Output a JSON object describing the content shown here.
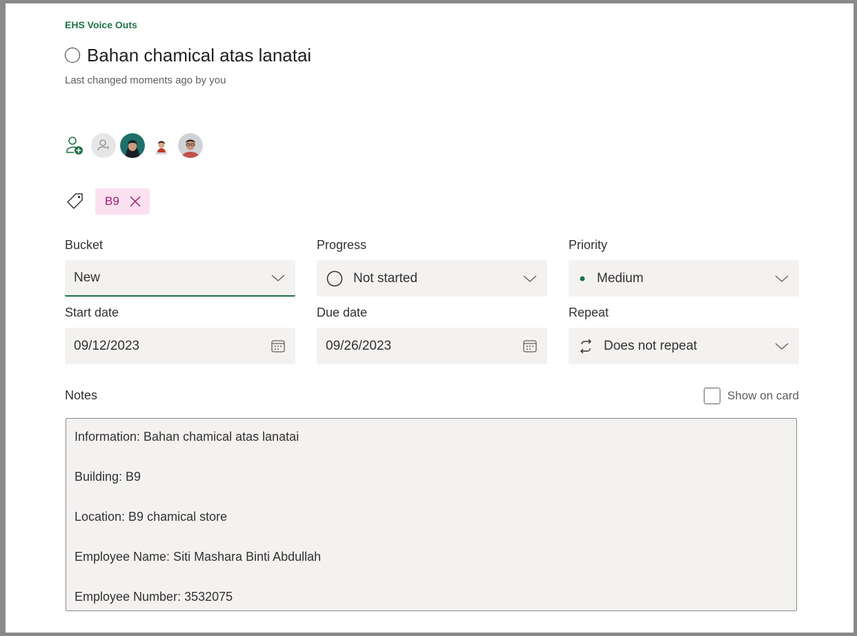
{
  "plan_name": "EHS Voice Outs",
  "task": {
    "title": "Bahan chamical atas lanatai",
    "last_changed": "Last changed moments ago by you"
  },
  "assignees": {
    "add_icon": "add-person-icon",
    "members": [
      {
        "icon": "person-unknown-icon"
      },
      {
        "icon": "avatar-photo"
      },
      {
        "icon": "avatar-photo"
      },
      {
        "icon": "avatar-photo"
      }
    ]
  },
  "labels": {
    "icon": "tag-icon",
    "items": [
      {
        "text": "B9",
        "color": "#fbe0f0"
      }
    ]
  },
  "fields": {
    "bucket": {
      "label": "Bucket",
      "value": "New"
    },
    "progress": {
      "label": "Progress",
      "value": "Not started"
    },
    "priority": {
      "label": "Priority",
      "value": "Medium",
      "dot_color": "#1e7145"
    },
    "start_date": {
      "label": "Start date",
      "value": "09/12/2023"
    },
    "due_date": {
      "label": "Due date",
      "value": "09/26/2023"
    },
    "repeat": {
      "label": "Repeat",
      "value": "Does not repeat"
    }
  },
  "notes": {
    "label": "Notes",
    "show_on_card": "Show on card",
    "show_on_card_checked": false,
    "lines": [
      "Information: Bahan chamical atas lanatai",
      "Building: B9",
      "Location: B9 chamical store",
      "Employee Name: Siti Mashara Binti Abdullah",
      "Employee Number: 3532075"
    ]
  },
  "colors": {
    "accent": "#1e7145",
    "field_bg": "#f3f2f1",
    "label_pink_bg": "#fbe0f0",
    "label_pink_text": "#9b1d6a"
  }
}
